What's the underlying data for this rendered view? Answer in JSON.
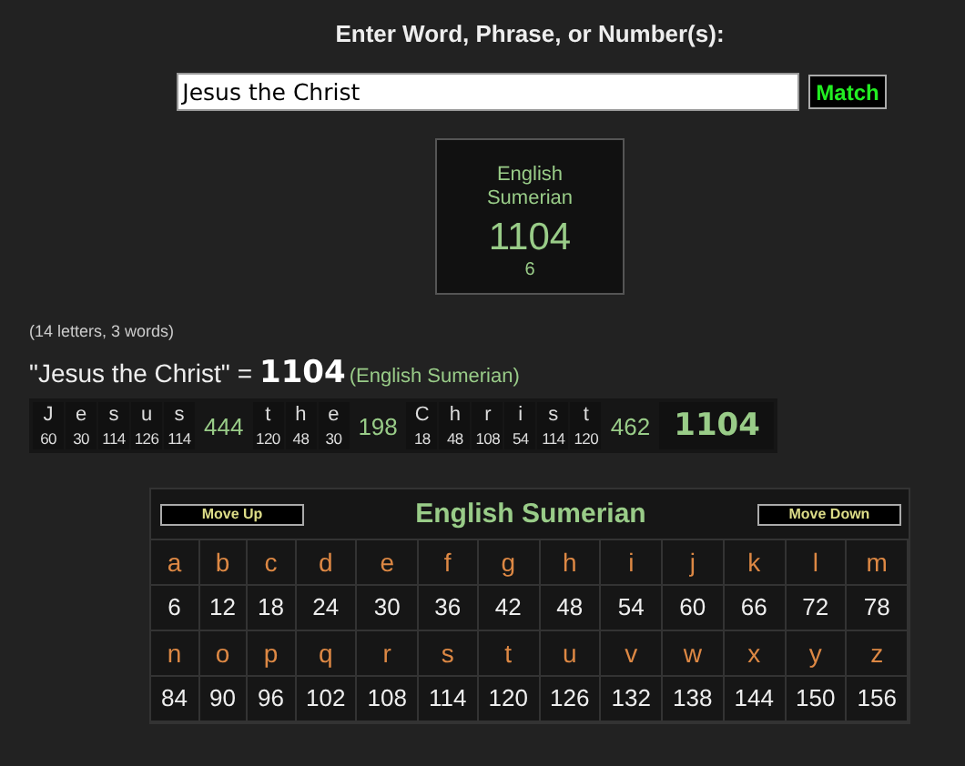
{
  "prompt": "Enter Word, Phrase, or Number(s):",
  "input": {
    "value": "Jesus the Christ"
  },
  "match_button": "Match",
  "result_card": {
    "cipher": "English Sumerian",
    "total": "1104",
    "reduction": "6"
  },
  "stats": "(14 letters, 3 words)",
  "equation": {
    "phrase": "\"Jesus the Christ\"",
    "equals": "=",
    "total": "1104",
    "cipher": "(English Sumerian)"
  },
  "breakdown": {
    "words": [
      {
        "letters": [
          {
            "char": "J",
            "value": "60"
          },
          {
            "char": "e",
            "value": "30"
          },
          {
            "char": "s",
            "value": "114"
          },
          {
            "char": "u",
            "value": "126"
          },
          {
            "char": "s",
            "value": "114"
          }
        ],
        "total": "444"
      },
      {
        "letters": [
          {
            "char": "t",
            "value": "120"
          },
          {
            "char": "h",
            "value": "48"
          },
          {
            "char": "e",
            "value": "30"
          }
        ],
        "total": "198"
      },
      {
        "letters": [
          {
            "char": "C",
            "value": "18"
          },
          {
            "char": "h",
            "value": "48"
          },
          {
            "char": "r",
            "value": "108"
          },
          {
            "char": "i",
            "value": "54"
          },
          {
            "char": "s",
            "value": "114"
          },
          {
            "char": "t",
            "value": "120"
          }
        ],
        "total": "462"
      }
    ],
    "total": "1104"
  },
  "cipher_table": {
    "move_up": "Move Up",
    "title": "English Sumerian",
    "move_down": "Move Down",
    "rows": [
      [
        {
          "letter": "a",
          "value": "6"
        },
        {
          "letter": "b",
          "value": "12"
        },
        {
          "letter": "c",
          "value": "18"
        },
        {
          "letter": "d",
          "value": "24"
        },
        {
          "letter": "e",
          "value": "30"
        },
        {
          "letter": "f",
          "value": "36"
        },
        {
          "letter": "g",
          "value": "42"
        },
        {
          "letter": "h",
          "value": "48"
        },
        {
          "letter": "i",
          "value": "54"
        },
        {
          "letter": "j",
          "value": "60"
        },
        {
          "letter": "k",
          "value": "66"
        },
        {
          "letter": "l",
          "value": "72"
        },
        {
          "letter": "m",
          "value": "78"
        }
      ],
      [
        {
          "letter": "n",
          "value": "84"
        },
        {
          "letter": "o",
          "value": "90"
        },
        {
          "letter": "p",
          "value": "96"
        },
        {
          "letter": "q",
          "value": "102"
        },
        {
          "letter": "r",
          "value": "108"
        },
        {
          "letter": "s",
          "value": "114"
        },
        {
          "letter": "t",
          "value": "120"
        },
        {
          "letter": "u",
          "value": "126"
        },
        {
          "letter": "v",
          "value": "132"
        },
        {
          "letter": "w",
          "value": "138"
        },
        {
          "letter": "x",
          "value": "144"
        },
        {
          "letter": "y",
          "value": "150"
        },
        {
          "letter": "z",
          "value": "156"
        }
      ]
    ]
  }
}
